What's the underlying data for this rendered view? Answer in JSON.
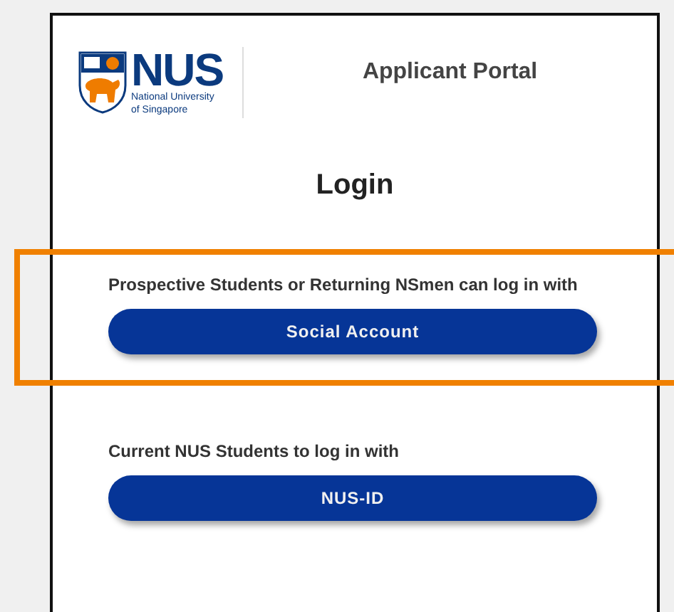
{
  "header": {
    "logo": {
      "wordmark": "NUS",
      "subtitle_line_1": "National University",
      "subtitle_line_2": "of Singapore"
    },
    "title": "Applicant Portal"
  },
  "heading": "Login",
  "login_options": [
    {
      "prompt": "Prospective Students or Returning NSmen can log in with",
      "button": "Social Account",
      "highlighted": true
    },
    {
      "prompt": "Current NUS Students to log in with",
      "button": "NUS-ID",
      "highlighted": false
    }
  ]
}
